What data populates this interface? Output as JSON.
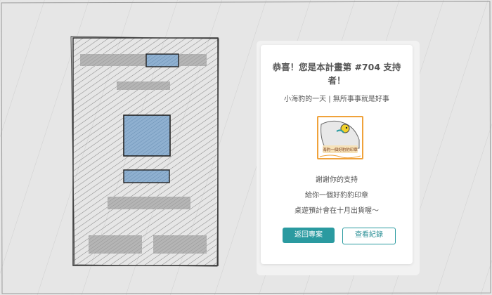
{
  "card": {
    "title": "恭喜！您是本計畫第 #704 支持者！",
    "subtitle": "小海豹的一天 | 無所事事就是好事",
    "stamp_text": "海豹一個好豹豹印章",
    "messages": [
      "謝謝你的支持",
      "給你一個好豹豹印章",
      "桌遊預計會在十月出貨喔～"
    ],
    "primary_button": "返回專案",
    "secondary_button": "查看紀錄"
  },
  "colors": {
    "accent": "#2a9aa0",
    "stamp_border": "#f0a23a"
  }
}
